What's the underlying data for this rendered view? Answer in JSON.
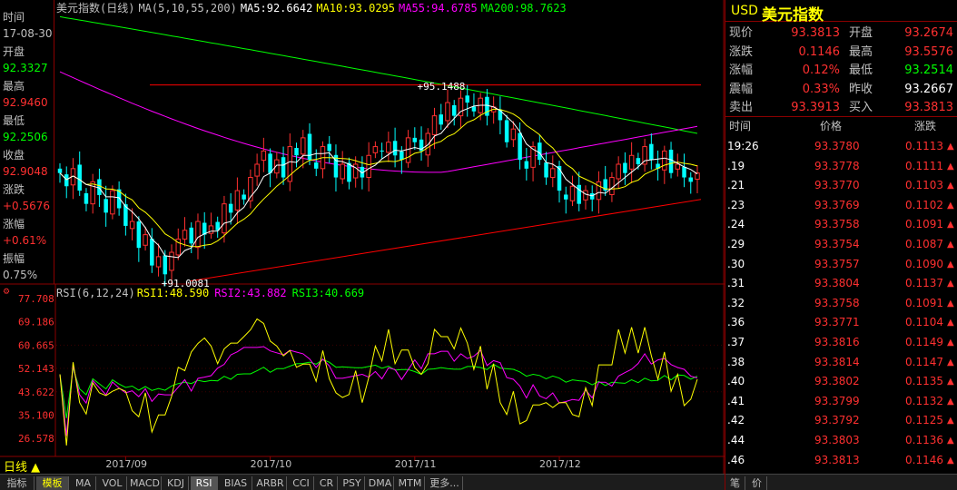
{
  "colors": {
    "up": "#ff3030",
    "down": "#00ffff",
    "ma5": "#ffffff",
    "ma10": "#ffff00",
    "ma55": "#ff00ff",
    "ma200": "#00ff00",
    "rsi1": "#ffffff",
    "rsi2": "#ff00ff",
    "rsi3": "#00ff00",
    "trend": "#ff0000",
    "grid": "#8b0000"
  },
  "left_panel": [
    {
      "label": "时间",
      "value": "17-08-30",
      "color": "#c0c0c0"
    },
    {
      "label": "开盘",
      "value": "92.3327",
      "color": "#00ff00"
    },
    {
      "label": "最高",
      "value": "92.9460",
      "color": "#ff3030"
    },
    {
      "label": "最低",
      "value": "92.2506",
      "color": "#00ff00"
    },
    {
      "label": "收盘",
      "value": "92.9048",
      "color": "#ff3030"
    },
    {
      "label": "涨跌",
      "value": "+0.5676",
      "color": "#ff3030"
    },
    {
      "label": "涨幅",
      "value": "+0.61%",
      "color": "#ff3030"
    },
    {
      "label": "振幅",
      "value": "0.75%",
      "color": "#c0c0c0"
    }
  ],
  "main_header": {
    "title": "美元指数(日线)",
    "params": "MA(5,10,55,200)",
    "ma5": "MA5:92.6642",
    "ma10": "MA10:93.0295",
    "ma55": "MA55:94.6785",
    "ma200": "MA200:98.7623"
  },
  "annotations": {
    "high": "95.1488",
    "low": "91.0081"
  },
  "indicator": {
    "header": "RSI(6,12,24)",
    "rsi1": "RSI1:48.590",
    "rsi2": "RSI2:43.882",
    "rsi3": "RSI3:40.669",
    "axis_labels": [
      "77.708",
      "69.186",
      "60.665",
      "52.143",
      "43.622",
      "35.100",
      "26.578"
    ]
  },
  "x_labels": [
    "2017/09",
    "2017/10",
    "2017/11",
    "2017/12"
  ],
  "period_label": "日线",
  "tabs": [
    "指标",
    "模板",
    "MA",
    "VOL",
    "MACD",
    "KDJ",
    "RSI",
    "BIAS",
    "ARBR",
    "CCI",
    "CR",
    "PSY",
    "DMA",
    "MTM",
    "更多..."
  ],
  "active_tab": "RSI",
  "quote": {
    "code": "USD",
    "name": "美元指数",
    "rows": [
      {
        "l1": "现价",
        "v1": "93.3813",
        "c1": "#ff3030",
        "l2": "开盘",
        "v2": "93.2674",
        "c2": "#ff3030"
      },
      {
        "l1": "涨跌",
        "v1": "0.1146",
        "c1": "#ff3030",
        "l2": "最高",
        "v2": "93.5576",
        "c2": "#ff3030"
      },
      {
        "l1": "涨幅",
        "v1": "0.12%",
        "c1": "#ff3030",
        "l2": "最低",
        "v2": "93.2514",
        "c2": "#00ff00"
      },
      {
        "l1": "震幅",
        "v1": "0.33%",
        "c1": "#ff3030",
        "l2": "昨收",
        "v2": "93.2667",
        "c2": "#ffffff"
      },
      {
        "l1": "卖出",
        "v1": "93.3913",
        "c1": "#ff3030",
        "l2": "买入",
        "v2": "93.3813",
        "c2": "#ff3030"
      }
    ]
  },
  "ticks_header": {
    "time": "时间",
    "price": "价格",
    "change": "涨跌"
  },
  "ticks": [
    {
      "time": "19:26",
      "price": "93.3780",
      "change": "0.1113"
    },
    {
      "time": ".19",
      "price": "93.3778",
      "change": "0.1111"
    },
    {
      "time": ".21",
      "price": "93.3770",
      "change": "0.1103"
    },
    {
      "time": ".23",
      "price": "93.3769",
      "change": "0.1102"
    },
    {
      "time": ".24",
      "price": "93.3758",
      "change": "0.1091"
    },
    {
      "time": ".29",
      "price": "93.3754",
      "change": "0.1087"
    },
    {
      "time": ".30",
      "price": "93.3757",
      "change": "0.1090"
    },
    {
      "time": ".31",
      "price": "93.3804",
      "change": "0.1137"
    },
    {
      "time": ".32",
      "price": "93.3758",
      "change": "0.1091"
    },
    {
      "time": ".36",
      "price": "93.3771",
      "change": "0.1104"
    },
    {
      "time": ".37",
      "price": "93.3816",
      "change": "0.1149"
    },
    {
      "time": ".38",
      "price": "93.3814",
      "change": "0.1147"
    },
    {
      "time": ".40",
      "price": "93.3802",
      "change": "0.1135"
    },
    {
      "time": ".41",
      "price": "93.3799",
      "change": "0.1132"
    },
    {
      "time": ".42",
      "price": "93.3792",
      "change": "0.1125"
    },
    {
      "time": ".44",
      "price": "93.3803",
      "change": "0.1136"
    },
    {
      "time": ".46",
      "price": "93.3813",
      "change": "0.1146"
    }
  ],
  "bottom_right_tabs": [
    "笔",
    "价"
  ]
}
